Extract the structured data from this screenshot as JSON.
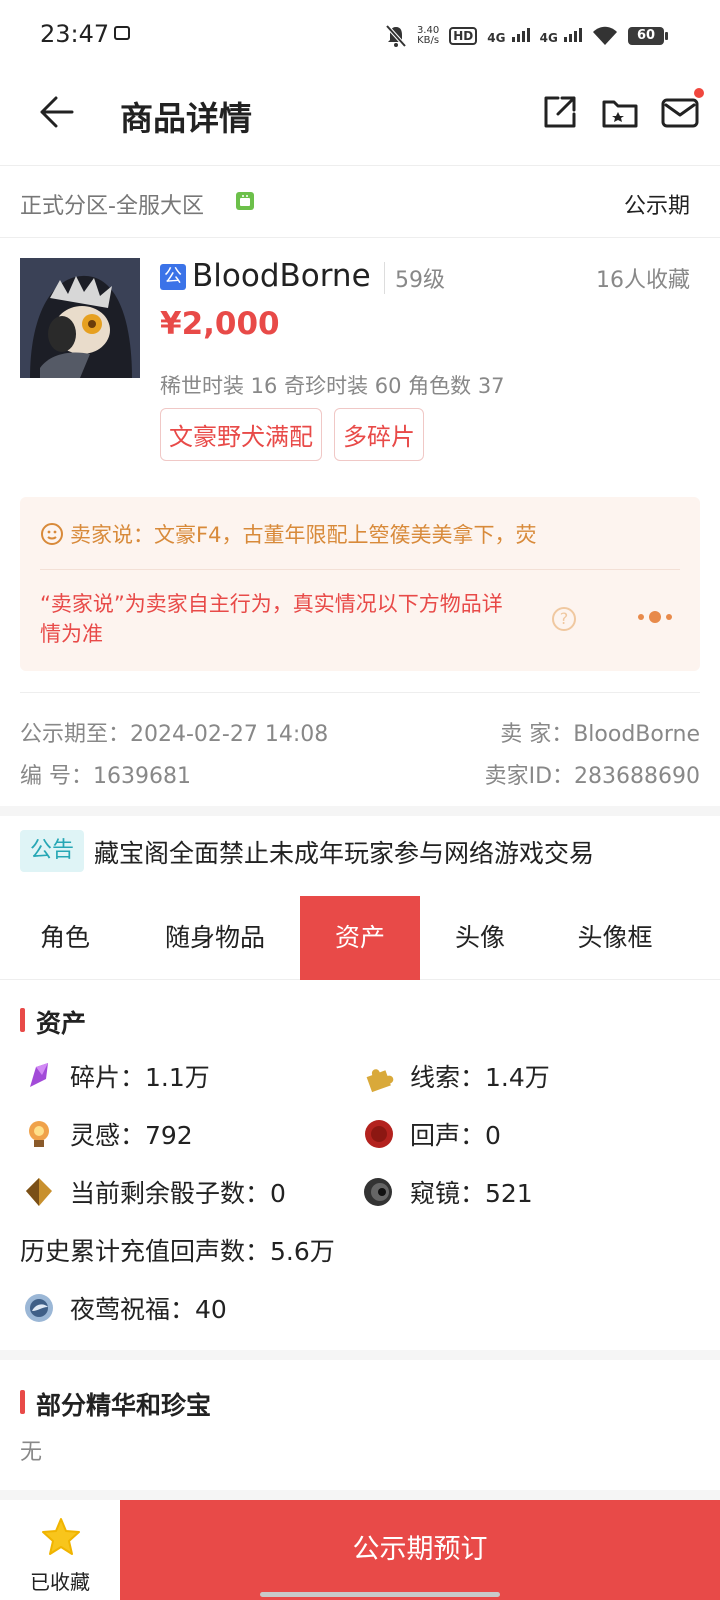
{
  "status_bar": {
    "time": "23:47",
    "speed_top": "3.40",
    "speed_bottom": "KB/s",
    "hd": "HD",
    "net1": "4G",
    "net2": "4G",
    "battery": "60"
  },
  "header": {
    "title": "商品详情"
  },
  "zone": {
    "name": "正式分区-全服大区",
    "period": "公示期"
  },
  "product": {
    "seller_chip": "公",
    "name": "BloodBorne",
    "level": "59级",
    "favorites": "16人收藏",
    "price": "¥2,000",
    "stats": "稀世时装 16  奇珍时装 60  角色数 37",
    "tags": [
      "文豪野犬满配",
      "多碎片"
    ]
  },
  "seller_says": {
    "text": "卖家说：文豪F4，古董年限配上箜篌美美拿下，荧",
    "disclaimer": "“卖家说”为卖家自主行为，真实情况以下方物品详情为准",
    "help": "?"
  },
  "meta": {
    "public_until": "公示期至：2024-02-27 14:08",
    "seller": "卖  家：BloodBorne",
    "number": "编  号：1639681",
    "seller_id": "卖家ID：283688690"
  },
  "notice": {
    "tag": "公告",
    "text": "藏宝阁全面禁止未成年玩家参与网络游戏交易"
  },
  "tabs": [
    {
      "label": "角色"
    },
    {
      "label": "随身物品"
    },
    {
      "label": "资产"
    },
    {
      "label": "头像"
    },
    {
      "label": "头像框"
    }
  ],
  "assets": {
    "title": "资产",
    "items": [
      {
        "label": "碎片：1.1万",
        "icon": "crystal-icon"
      },
      {
        "label": "线索：1.4万",
        "icon": "puzzle-icon"
      },
      {
        "label": "灵感：792",
        "icon": "lightbulb-icon"
      },
      {
        "label": "回声：0",
        "icon": "wax-seal-icon"
      },
      {
        "label": "当前剩余骰子数：0",
        "icon": "dice-icon"
      },
      {
        "label": "窥镜：521",
        "icon": "lens-icon"
      },
      {
        "label": "历史累计充值回声数：5.6万",
        "icon": ""
      },
      {
        "label": "夜莺祝福：40",
        "icon": "nightingale-icon"
      }
    ]
  },
  "treasures": {
    "title": "部分精华和珍宝",
    "value": "无"
  },
  "bottom": {
    "fav_label": "已收藏",
    "reserve_label": "公示期预订"
  },
  "colors": {
    "accent": "#e84a48",
    "notice": "#27a7b5",
    "seller_box_bg": "#fdf4ef",
    "link_blue": "#3b73e8"
  }
}
